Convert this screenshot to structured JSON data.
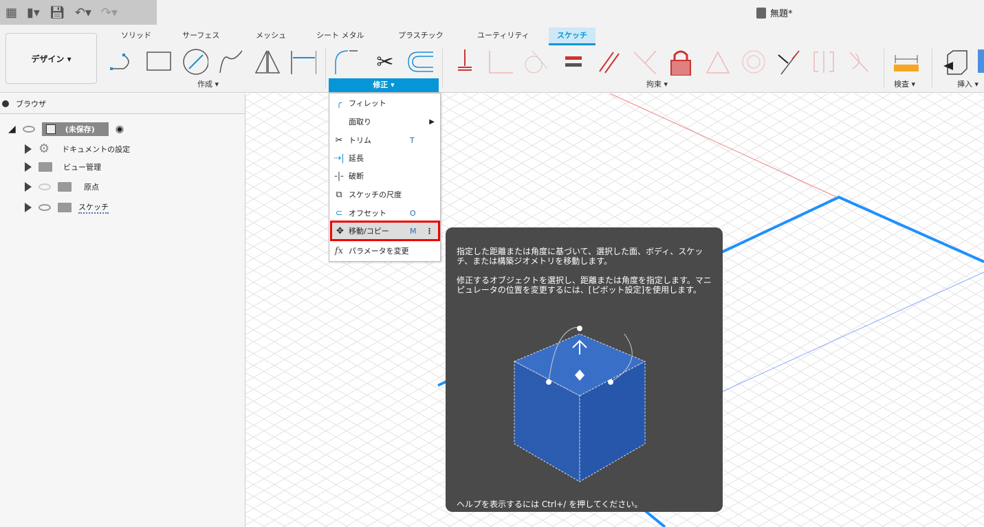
{
  "window": {
    "title": "無題*"
  },
  "quick_access": {
    "icons": [
      "grid-menu-icon",
      "file-icon",
      "save-icon",
      "undo-icon",
      "redo-icon"
    ]
  },
  "workspace": {
    "label": "デザイン ▾"
  },
  "tabs": [
    "ソリッド",
    "サーフェス",
    "メッシュ",
    "シート メタル",
    "プラスチック",
    "ユーティリティ",
    "スケッチ"
  ],
  "active_tab": "スケッチ",
  "groups": {
    "create": "作成 ▾",
    "modify": "修正 ▾",
    "constraints": "拘束 ▾",
    "inspect": "検査 ▾",
    "insert": "挿入 ▾"
  },
  "browser": {
    "title": "ブラウザ",
    "root": "(未保存)",
    "items": [
      "ドキュメントの設定",
      "ビュー管理",
      "原点",
      "スケッチ"
    ]
  },
  "modify_menu": [
    {
      "label": "フィレット",
      "shortcut": ""
    },
    {
      "label": "面取り",
      "shortcut": "▶"
    },
    {
      "label": "トリム",
      "shortcut": "T"
    },
    {
      "label": "延長",
      "shortcut": ""
    },
    {
      "label": "破断",
      "shortcut": ""
    },
    {
      "label": "スケッチの尺度",
      "shortcut": ""
    },
    {
      "label": "オフセット",
      "shortcut": "O"
    },
    {
      "label": "移動/コピー",
      "shortcut": "M",
      "more": "⋮"
    },
    {
      "label": "パラメータを変更",
      "shortcut": ""
    }
  ],
  "tooltip": {
    "p1": "指定した距離または角度に基づいて、選択した面、ボディ、スケッチ、または構築ジオメトリを移動します。",
    "p2": "修正するオブジェクトを選択し、距離または角度を指定します。マニピュレータの位置を変更するには、[ピボット設定]を使用します。",
    "help": "ヘルプを表示するには Ctrl+/ を押してください。"
  },
  "colors": {
    "accent": "#0696d7",
    "highlight": "#e00000",
    "tooltip_bg": "#4a4a4a",
    "constraint": "#d9534f"
  }
}
